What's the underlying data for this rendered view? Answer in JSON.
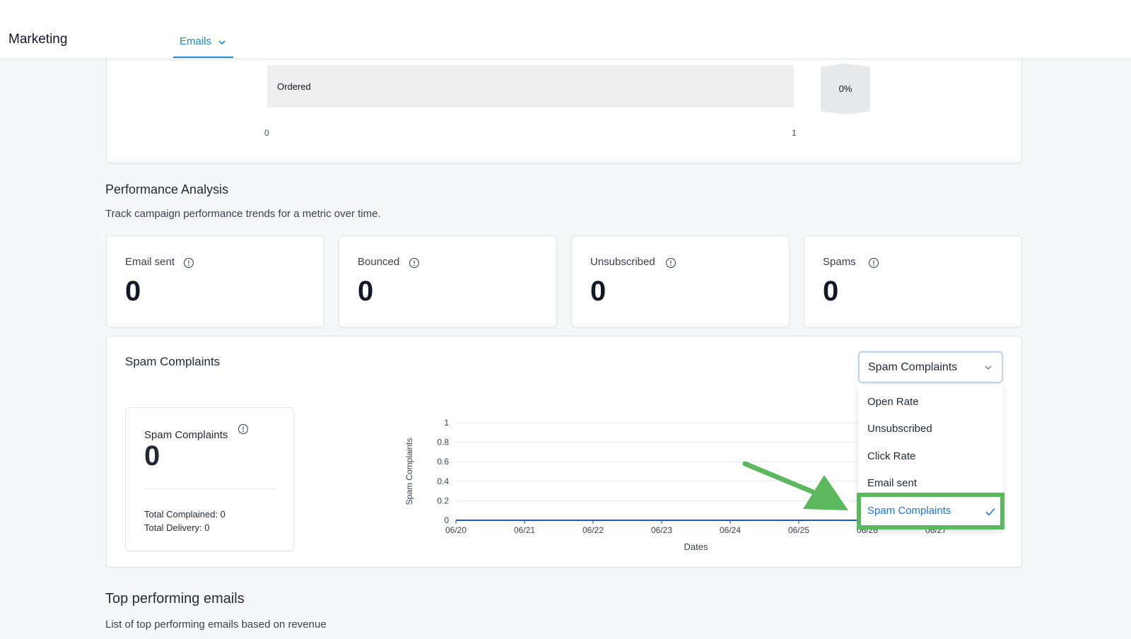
{
  "header": {
    "app_title": "Marketing",
    "tab_label": "Emails"
  },
  "funnel": {
    "bar_label": "Ordered",
    "percent": "0%",
    "ticks": [
      "0",
      "1"
    ]
  },
  "performance": {
    "title": "Performance Analysis",
    "subtitle": "Track campaign performance trends for a metric over time.",
    "metrics": [
      {
        "label": "Email sent",
        "value": "0"
      },
      {
        "label": "Bounced",
        "value": "0"
      },
      {
        "label": "Unsubscribed",
        "value": "0"
      },
      {
        "label": "Spams",
        "value": "0"
      }
    ]
  },
  "spam_panel": {
    "title": "Spam Complaints",
    "stat_label": "Spam Complaints",
    "stat_value": "0",
    "total_complained": "Total Complained: 0",
    "total_delivery": "Total Delivery: 0",
    "dropdown": {
      "selected": "Spam Complaints",
      "options": [
        "Open Rate",
        "Unsubscribed",
        "Click Rate",
        "Email sent",
        "Spam Complaints"
      ]
    }
  },
  "chart_data": {
    "type": "line",
    "x": [
      "06/20",
      "06/21",
      "06/22",
      "06/23",
      "06/24",
      "06/25",
      "06/26",
      "06/27"
    ],
    "series": [
      {
        "values": [
          0,
          0,
          0,
          0,
          0,
          0,
          0,
          0
        ]
      }
    ],
    "yticks": [
      "0",
      "0.2",
      "0.4",
      "0.6",
      "0.8",
      "1"
    ],
    "ylim": [
      0,
      1
    ],
    "ylabel": "Spam Complaints",
    "xlabel": "Dates",
    "grid": true,
    "color": "#1a56db"
  },
  "top_emails": {
    "title": "Top performing emails",
    "subtitle": "List of top performing emails based on revenue"
  },
  "colors": {
    "accent": "#1a8ad6",
    "highlight": "#5cb85c",
    "selected_text": "#1a73e8"
  }
}
